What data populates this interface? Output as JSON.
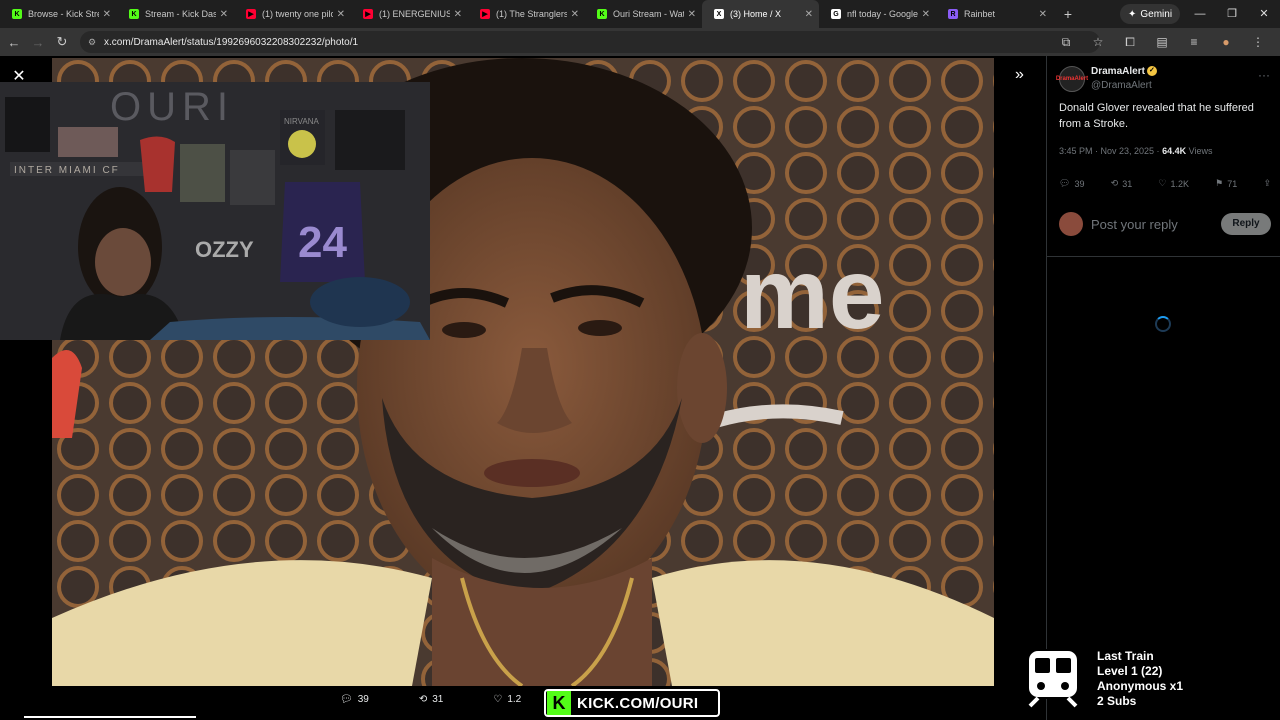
{
  "tabs": [
    {
      "title": "Browse - Kick Strea",
      "color": "#53fc18",
      "icon": "kick-icon"
    },
    {
      "title": "Stream - Kick Dashb",
      "color": "#53fc18",
      "icon": "kick-icon"
    },
    {
      "title": "(1) twenty one pilot",
      "color": "#ff0033",
      "icon": "youtube-icon"
    },
    {
      "title": "(1) ENERGENIUS - C",
      "color": "#ff0033",
      "icon": "youtube-icon"
    },
    {
      "title": "(1) The Stranglers -",
      "color": "#ff0033",
      "icon": "youtube-icon"
    },
    {
      "title": "Ouri Stream - Watc",
      "color": "#53fc18",
      "icon": "kick-icon"
    },
    {
      "title": "(3) Home / X",
      "color": "#ffffff",
      "icon": "x-icon",
      "active": true
    },
    {
      "title": "nfl today - Google",
      "color": "#ffffff",
      "icon": "google-icon"
    },
    {
      "title": "Rainbet",
      "color": "#8a5cf6",
      "icon": "rainbet-icon"
    }
  ],
  "gemini_label": "Gemini",
  "url": "x.com/DramaAlert/status/1992696032208302232/photo/1",
  "photo_actions": {
    "replies": "39",
    "reposts": "31",
    "likes": "1.2"
  },
  "kick_banner": "KICK.COM/OURI",
  "webcam": {
    "wall_text": "OURI",
    "banner_text": "INTER MIAMI CF",
    "jersey_number": "24",
    "poster_text": "OZZY",
    "nirvana": "NIRVANA"
  },
  "photo_sign": "me",
  "tweet": {
    "author_name": "DramaAlert",
    "handle": "@DramaAlert",
    "avatar_text": "DramaAlert",
    "text": "Donald Glover revealed that he suffered from a Stroke.",
    "time": "3:45 PM · Nov 23, 2025 ·",
    "views_count": "64.4K",
    "views_label": "Views",
    "stats": {
      "replies": "39",
      "reposts": "31",
      "likes": "1.2K",
      "bookmarks": "71"
    },
    "reply_placeholder": "Post your reply",
    "reply_button": "Reply"
  },
  "train": {
    "title": "Last Train",
    "level": "Level 1  (22)",
    "user": "Anonymous x1",
    "subs": "2 Subs"
  }
}
